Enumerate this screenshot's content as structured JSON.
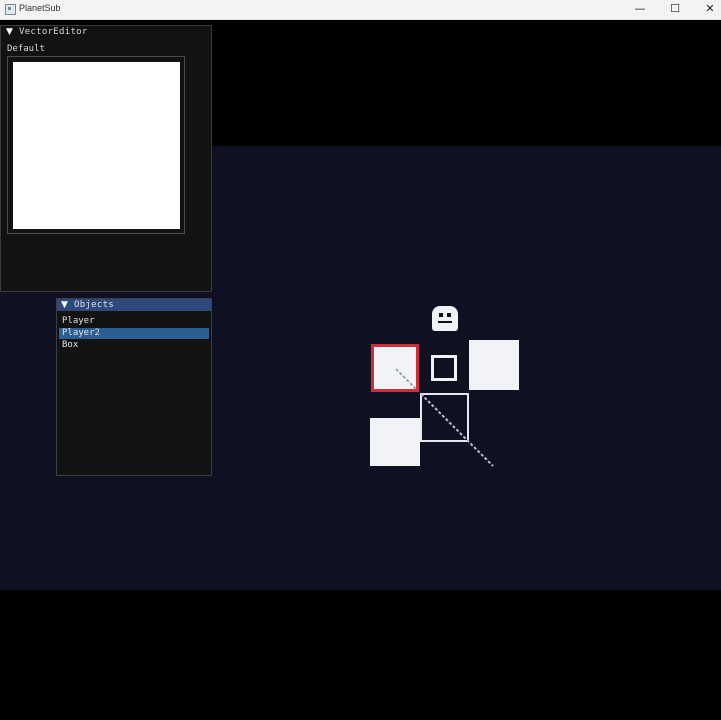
{
  "window": {
    "title": "PlanetSub",
    "minimize_glyph": "—",
    "maximize_glyph": "☐",
    "close_glyph": "✕"
  },
  "vector_editor": {
    "arrow": "▼",
    "title": "VectorEditor",
    "label": "Default"
  },
  "objects": {
    "arrow": "▼",
    "title": "Objects",
    "items": [
      {
        "label": "Player",
        "selected": false
      },
      {
        "label": "Player2",
        "selected": true
      },
      {
        "label": "Box",
        "selected": false
      }
    ]
  },
  "colors": {
    "game_background": "#0f1123",
    "selection_border": "#d22b3c",
    "object_fill": "#f1f3f6",
    "header_blue": "#2d4a7a",
    "selected_item": "#2b5f94"
  }
}
